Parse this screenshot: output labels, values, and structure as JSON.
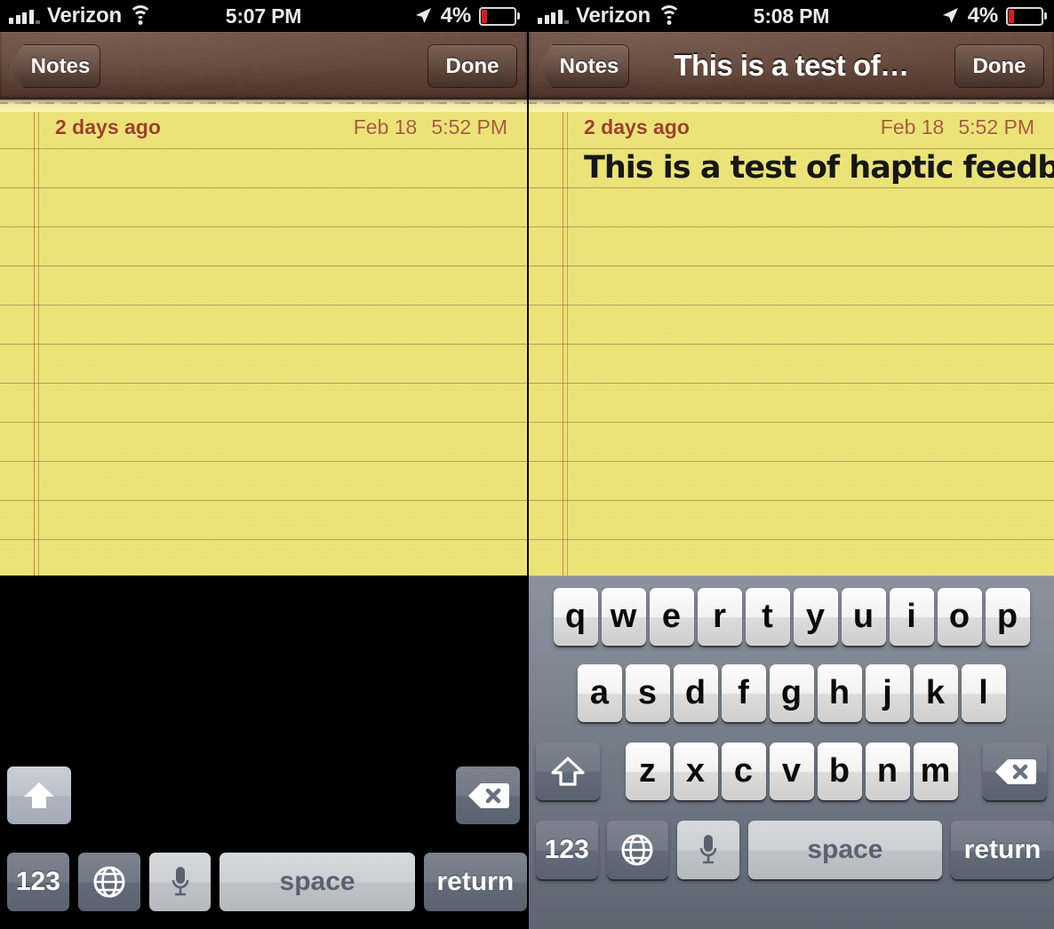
{
  "device": {
    "left": {
      "status": {
        "carrier": "Verizon",
        "time": "5:07 PM",
        "battery_pct": "4%"
      },
      "nav": {
        "back_label": "Notes",
        "title": "",
        "done_label": "Done"
      },
      "note": {
        "relative_date": "2 days ago",
        "date": "Feb 18",
        "time": "5:52 PM",
        "body": ""
      },
      "keyboard": {
        "state": "transitioning",
        "background": "#000000"
      }
    },
    "right": {
      "status": {
        "carrier": "Verizon",
        "time": "5:08 PM",
        "battery_pct": "4%"
      },
      "nav": {
        "back_label": "Notes",
        "title": "This is a test of…",
        "done_label": "Done"
      },
      "note": {
        "relative_date": "2 days ago",
        "date": "Feb 18",
        "time": "5:52 PM",
        "body": "This is a test of haptic feedback."
      },
      "keyboard": {
        "state": "visible",
        "background": "#767e8a"
      }
    }
  },
  "keyboard": {
    "row1": [
      "q",
      "w",
      "e",
      "r",
      "t",
      "y",
      "u",
      "i",
      "o",
      "p"
    ],
    "row2": [
      "a",
      "s",
      "d",
      "f",
      "g",
      "h",
      "j",
      "k",
      "l"
    ],
    "row3": [
      "z",
      "x",
      "c",
      "v",
      "b",
      "n",
      "m"
    ],
    "shift_label": "shift",
    "delete_label": "delete",
    "numeric_label": "123",
    "globe_label": "globe",
    "dictation_label": "dictation",
    "space_label": "space",
    "return_label": "return"
  },
  "icons": {
    "signal": "signal-bars-icon",
    "wifi": "wifi-icon",
    "location": "location-arrow-icon",
    "battery": "battery-icon",
    "shift": "shift-arrow-icon",
    "delete": "delete-backspace-icon",
    "globe": "globe-icon",
    "mic": "microphone-icon"
  },
  "colors": {
    "navbar": "#5a3e32",
    "paper": "#f7f191",
    "paper_rule": "#867c4e",
    "margin_rule": "#b43c2d",
    "meta_text": "#9e4128",
    "keyboard_bg": "#767e8a",
    "key_face": "#f2f2f2",
    "key_dark": "#6b7380",
    "battery_low": "#e01b1b",
    "caret": "#5c4433"
  }
}
